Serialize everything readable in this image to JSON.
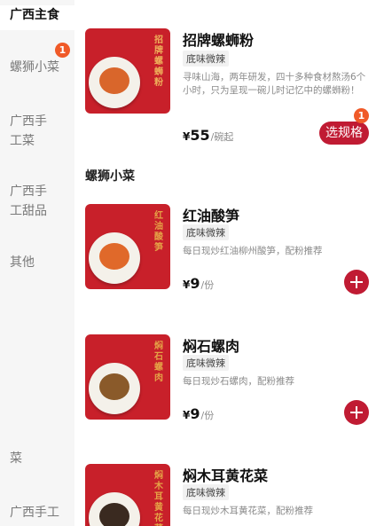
{
  "sidebar": {
    "items": [
      {
        "label": "广西主食",
        "active": true
      },
      {
        "label": "螺狮小菜",
        "badge": "1"
      },
      {
        "label": "广西手工菜"
      },
      {
        "label": "广西手工甜品"
      },
      {
        "label": "其他"
      },
      {
        "label": "菜"
      },
      {
        "label": "广西手工"
      }
    ]
  },
  "main": {
    "section_title": "螺狮小菜",
    "dishes": [
      {
        "name": "招牌螺蛳粉",
        "tag": "底味微辣",
        "desc": "寻味山海，两年研发，四十多种食材熬汤6个小时，只为呈现一碗儿时记忆中的螺蛳粉！",
        "currency": "¥",
        "price": "55",
        "unit": "/碗起",
        "action": "选规格",
        "action_badge": "1"
      },
      {
        "name": "红油酸笋",
        "tag": "底味微辣",
        "desc": "每日现炒红油柳州酸笋，配粉推荐",
        "currency": "¥",
        "price": "9",
        "unit": "/份"
      },
      {
        "name": "焖石螺肉",
        "tag": "底味微辣",
        "desc": "每日现炒石螺肉，配粉推荐",
        "currency": "¥",
        "price": "9",
        "unit": "/份"
      },
      {
        "name": "焖木耳黄花菜",
        "tag": "底味微辣",
        "desc": "每日现炒木耳黄花菜，配粉推荐"
      }
    ]
  },
  "colors": {
    "accent": "#c01b33",
    "badge": "#f05a28",
    "thumb_bg": "#c8202a"
  },
  "icons": {
    "add": "plus-circle-icon"
  }
}
